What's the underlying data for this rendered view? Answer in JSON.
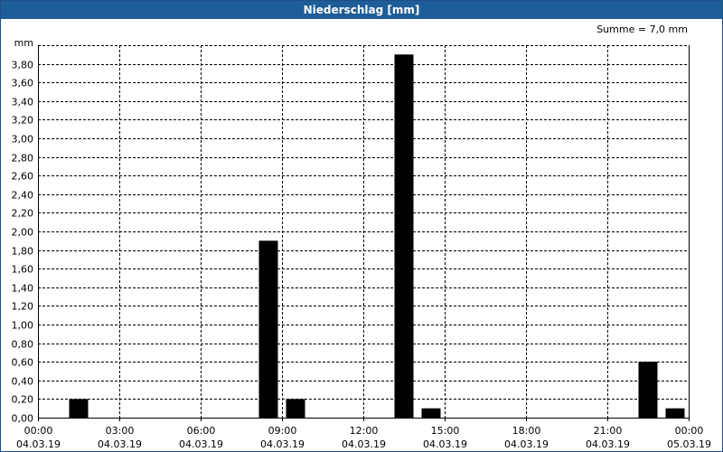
{
  "window": {
    "title": "Niederschlag [mm]"
  },
  "summary": "Summe = 7,0 mm",
  "chart_data": {
    "type": "bar",
    "title": "Niederschlag [mm]",
    "xlabel": "",
    "ylabel": "mm",
    "ylim": [
      0,
      4.0
    ],
    "y_ticks": [
      "0,00",
      "0,20",
      "0,40",
      "0,60",
      "0,80",
      "1,00",
      "1,20",
      "1,40",
      "1,60",
      "1,80",
      "2,00",
      "2,20",
      "2,40",
      "2,60",
      "2,80",
      "3,00",
      "3,20",
      "3,40",
      "3,60",
      "3,80"
    ],
    "x_ticks": [
      {
        "hour": 0,
        "time": "00:00",
        "date": "04.03.19"
      },
      {
        "hour": 3,
        "time": "03:00",
        "date": "04.03.19"
      },
      {
        "hour": 6,
        "time": "06:00",
        "date": "04.03.19"
      },
      {
        "hour": 9,
        "time": "09:00",
        "date": "04.03.19"
      },
      {
        "hour": 12,
        "time": "12:00",
        "date": "04.03.19"
      },
      {
        "hour": 15,
        "time": "15:00",
        "date": "04.03.19"
      },
      {
        "hour": 18,
        "time": "18:00",
        "date": "04.03.19"
      },
      {
        "hour": 21,
        "time": "21:00",
        "date": "04.03.19"
      },
      {
        "hour": 24,
        "time": "00:00",
        "date": "05.03.19"
      }
    ],
    "bars": [
      {
        "hour": 1.5,
        "value": 0.2
      },
      {
        "hour": 8.5,
        "value": 1.9
      },
      {
        "hour": 9.5,
        "value": 0.2
      },
      {
        "hour": 13.5,
        "value": 3.9
      },
      {
        "hour": 14.5,
        "value": 0.1
      },
      {
        "hour": 22.5,
        "value": 0.6
      },
      {
        "hour": 23.5,
        "value": 0.1
      }
    ],
    "grid": true,
    "bar_color": "#000000"
  }
}
